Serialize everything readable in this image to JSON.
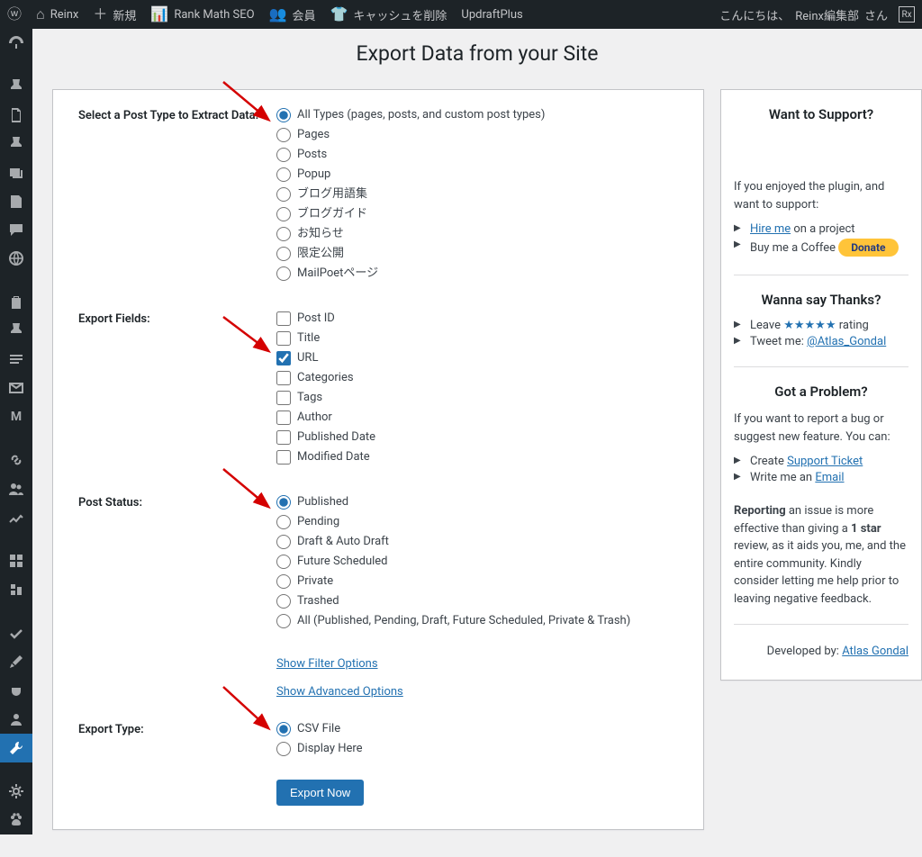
{
  "adminbar": {
    "site_name": "Reinx",
    "new": "新規",
    "rankmath": "Rank Math SEO",
    "members": "会員",
    "clear_cache": "キャッシュを削除",
    "updraft": "UpdraftPlus",
    "howdy": "こんにちは、",
    "user": "Reinx編集部",
    "san": "さん",
    "avatar_text": "Rx"
  },
  "page_title": "Export Data from your Site",
  "labels": {
    "post_type": "Select a Post Type to Extract Data:",
    "export_fields": "Export Fields:",
    "post_status": "Post Status:",
    "export_type": "Export Type:"
  },
  "post_types": [
    "All Types (pages, posts, and custom post types)",
    "Pages",
    "Posts",
    "Popup",
    "ブログ用語集",
    "ブログガイド",
    "お知らせ",
    "限定公開",
    "MailPoetページ"
  ],
  "fields": [
    "Post ID",
    "Title",
    "URL",
    "Categories",
    "Tags",
    "Author",
    "Published Date",
    "Modified Date"
  ],
  "statuses": [
    "Published",
    "Pending",
    "Draft & Auto Draft",
    "Future Scheduled",
    "Private",
    "Trashed",
    "All (Published, Pending, Draft, Future Scheduled, Private & Trash)"
  ],
  "export_types": [
    "CSV File",
    "Display Here"
  ],
  "links": {
    "filter": "Show Filter Options",
    "advanced": "Show Advanced Options"
  },
  "button_export": "Export Now",
  "sidebar": {
    "support_h": "Want to Support?",
    "support_p": "If you enjoyed the plugin, and want to support:",
    "hire": "Hire me",
    "hire_after": " on a project",
    "coffee": "Buy me a Coffee ",
    "donate": "Donate",
    "thanks_h": "Wanna say Thanks?",
    "leave": "Leave ",
    "stars": "★★★★★",
    "rating": " rating",
    "tweet": "Tweet me: ",
    "tweet_link": "@Atlas_Gondal",
    "problem_h": "Got a Problem?",
    "problem_p": "If you want to report a bug or suggest new feature. You can:",
    "ticket_pre": "Create ",
    "ticket_link": "Support Ticket",
    "email_pre": "Write me an ",
    "email_link": "Email",
    "reporting": "Reporting",
    "reporting_rest": " an issue is more effective than giving a ",
    "one_star": "1 star",
    "reporting_tail": " review, as it aids you, me, and the entire community. Kindly consider letting me help prior to leaving negative feedback.",
    "dev_by": "Developed by: ",
    "dev_link": "Atlas Gondal"
  }
}
